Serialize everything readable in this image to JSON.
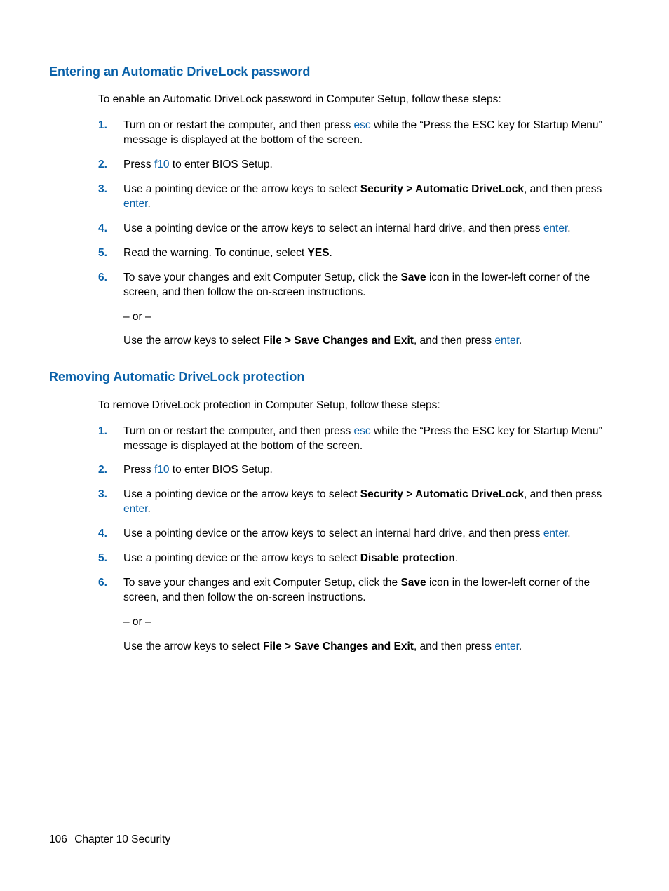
{
  "section1": {
    "heading": "Entering an Automatic DriveLock password",
    "intro": "To enable an Automatic DriveLock password in Computer Setup, follow these steps:",
    "steps": {
      "s1": {
        "num": "1.",
        "t1": "Turn on or restart the computer, and then press ",
        "k1": "esc",
        "t2": " while the “Press the ESC key for Startup Menu” message is displayed at the bottom of the screen."
      },
      "s2": {
        "num": "2.",
        "t1": "Press ",
        "k1": "f10",
        "t2": " to enter BIOS Setup."
      },
      "s3": {
        "num": "3.",
        "t1": "Use a pointing device or the arrow keys to select ",
        "b1": "Security > Automatic DriveLock",
        "t2": ", and then press ",
        "k1": "enter",
        "t3": "."
      },
      "s4": {
        "num": "4.",
        "t1": "Use a pointing device or the arrow keys to select an internal hard drive, and then press ",
        "k1": "enter",
        "t2": "."
      },
      "s5": {
        "num": "5.",
        "t1": "Read the warning. To continue, select ",
        "b1": "YES",
        "t2": "."
      },
      "s6": {
        "num": "6.",
        "p1t1": "To save your changes and exit Computer Setup, click the ",
        "p1b1": "Save",
        "p1t2": " icon in the lower-left corner of the screen, and then follow the on-screen instructions.",
        "p2": "– or –",
        "p3t1": "Use the arrow keys to select ",
        "p3b1": "File > Save Changes and Exit",
        "p3t2": ", and then press ",
        "p3k1": "enter",
        "p3t3": "."
      }
    }
  },
  "section2": {
    "heading": "Removing Automatic DriveLock protection",
    "intro": "To remove DriveLock protection in Computer Setup, follow these steps:",
    "steps": {
      "s1": {
        "num": "1.",
        "t1": "Turn on or restart the computer, and then press ",
        "k1": "esc",
        "t2": " while the “Press the ESC key for Startup Menu” message is displayed at the bottom of the screen."
      },
      "s2": {
        "num": "2.",
        "t1": "Press ",
        "k1": "f10",
        "t2": " to enter BIOS Setup."
      },
      "s3": {
        "num": "3.",
        "t1": "Use a pointing device or the arrow keys to select ",
        "b1": "Security > Automatic DriveLock",
        "t2": ", and then press ",
        "k1": "enter",
        "t3": "."
      },
      "s4": {
        "num": "4.",
        "t1": "Use a pointing device or the arrow keys to select an internal hard drive, and then press ",
        "k1": "enter",
        "t2": "."
      },
      "s5": {
        "num": "5.",
        "t1": "Use a pointing device or the arrow keys to select ",
        "b1": "Disable protection",
        "t2": "."
      },
      "s6": {
        "num": "6.",
        "p1t1": "To save your changes and exit Computer Setup, click the ",
        "p1b1": "Save",
        "p1t2": " icon in the lower-left corner of the screen, and then follow the on-screen instructions.",
        "p2": "– or –",
        "p3t1": "Use the arrow keys to select ",
        "p3b1": "File > Save Changes and Exit",
        "p3t2": ", and then press ",
        "p3k1": "enter",
        "p3t3": "."
      }
    }
  },
  "footer": {
    "page": "106",
    "chapter": "Chapter 10   Security"
  }
}
